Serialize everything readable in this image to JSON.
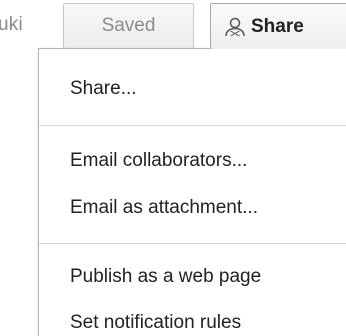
{
  "header": {
    "user_name_fragment": "uki",
    "saved_label": "Saved",
    "share_label": "Share"
  },
  "share_menu": {
    "items": [
      {
        "label": "Share..."
      },
      {
        "label": "Email collaborators..."
      },
      {
        "label": "Email as attachment..."
      },
      {
        "label": "Publish as a web page"
      },
      {
        "label": "Set notification rules"
      }
    ]
  },
  "icons": {
    "share_button_icon": "person-icon"
  },
  "colors": {
    "menu_border": "#b5b5b5",
    "text": "#222222",
    "muted_text": "#8c8c8c"
  }
}
